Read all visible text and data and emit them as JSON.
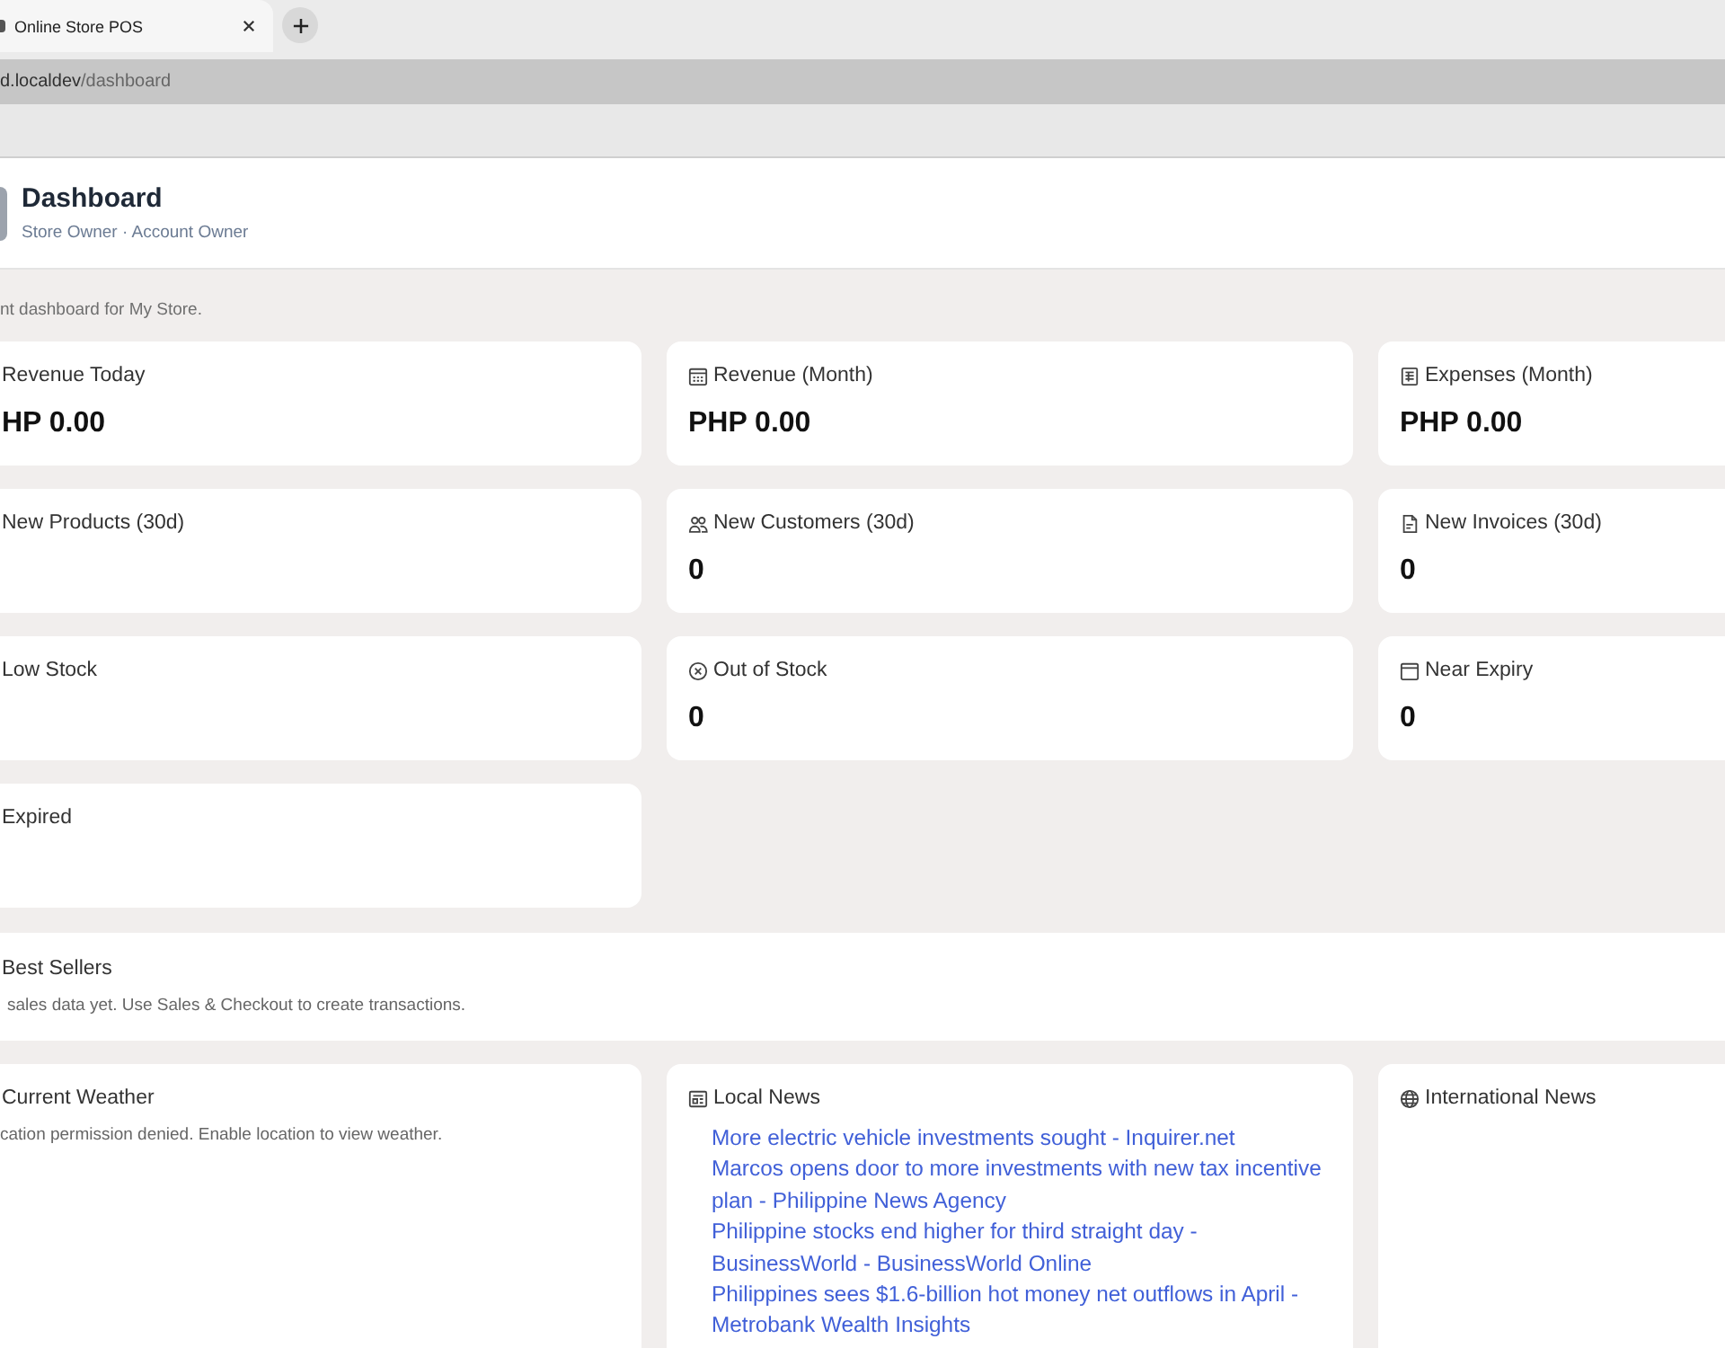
{
  "browser": {
    "tabs": [
      {
        "title": "Online Store POS",
        "selected": true
      }
    ],
    "address": {
      "host": "d.localdev",
      "path": "/dashboard"
    }
  },
  "header": {
    "title": "Dashboard",
    "subtitle": "Store Owner · Account Owner"
  },
  "intro": "nt dashboard for My Store.",
  "stats": [
    {
      "label": "Revenue Today",
      "value": "HP 0.00"
    },
    {
      "label": "Revenue (Month)",
      "value": "PHP 0.00"
    },
    {
      "label": "Expenses (Month)",
      "value": "PHP 0.00"
    },
    {
      "label": "New Products (30d)"
    },
    {
      "label": "New Customers (30d)",
      "value": "0"
    },
    {
      "label": "New Invoices (30d)",
      "value": "0"
    },
    {
      "label": "Low Stock"
    },
    {
      "label": "Out of Stock",
      "value": "0"
    },
    {
      "label": "Near Expiry",
      "value": "0"
    },
    {
      "label": "Expired"
    }
  ],
  "best_sellers": {
    "title": "Best Sellers",
    "message": "sales data yet. Use Sales & Checkout to create transactions."
  },
  "widgets": [
    {
      "kind": "message",
      "title": "Current Weather",
      "message": "cation permission denied. Enable location to view weather."
    },
    {
      "kind": "links",
      "title": "Local News",
      "links": [
        "More electric vehicle investments sought - Inquirer.net",
        "Marcos opens door to more investments with new tax incentive plan - Philippine News Agency",
        "Philippine stocks end higher for third straight day - BusinessWorld - BusinessWorld Online",
        "Philippines sees $1.6-billion hot money net outflows in April - Metrobank Wealth Insights"
      ]
    },
    {
      "kind": "links",
      "title": "International News"
    }
  ]
}
